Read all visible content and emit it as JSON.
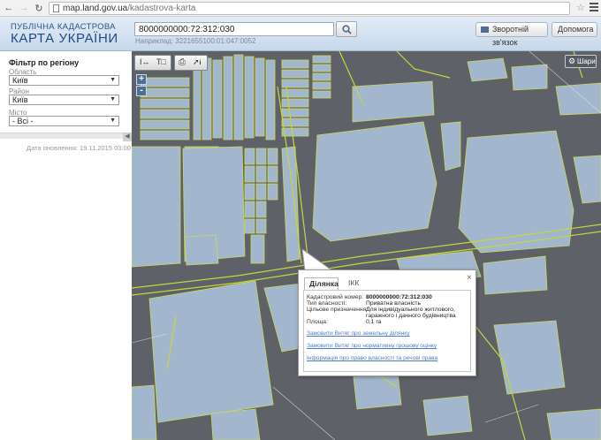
{
  "browser": {
    "url_host": "map.land.gov.ua",
    "url_path": "/kadastrova-karta"
  },
  "header": {
    "logo_top": "ПУБЛІЧНА КАДАСТРОВА",
    "logo_main": "КАРТА УКРАЇНИ",
    "search_value": "8000000000:72:312:030",
    "search_hint": "Наприклад: 3221655100:01:047:0052",
    "feedback_label": "Зворотній зв'язок",
    "help_label": "Допомога"
  },
  "sidebar": {
    "filter_title": "Фільтр по регіону",
    "oblast_label": "Область",
    "oblast_value": "Київ",
    "raion_label": "Район",
    "raion_value": "Київ",
    "misto_label": "Місто",
    "misto_value": "- Всі -",
    "update_date": "Дата оновлення: 19.11.2015 03:00"
  },
  "map": {
    "layers_label": "Шари",
    "zoom_in": "+",
    "zoom_out": "-",
    "tool_info_label": "i",
    "colors": {
      "background": "#5e6268",
      "parcel": "#a8bfd6",
      "parcel_border": "#d6e25a",
      "road": "#c6d63a"
    }
  },
  "popup": {
    "tab_parcel": "Ділянка",
    "tab_ikk": "ІКК",
    "close": "×",
    "rows": [
      {
        "label": "Кадастровий номер:",
        "value": "8000000000:72:312:030"
      },
      {
        "label": "Тип власності:",
        "value": "Приватна власність"
      },
      {
        "label": "Цільове призначення:",
        "value": "Для індивідуального житлового, гаражного і дачного будівництва"
      },
      {
        "label": "Площа:",
        "value": "0.1 га"
      }
    ],
    "links": [
      "Замовити Витяг про земельну ділянку",
      "Замовити Витяг про нормативну грошову оцінку",
      "Інформація про право власності та речові права"
    ]
  }
}
